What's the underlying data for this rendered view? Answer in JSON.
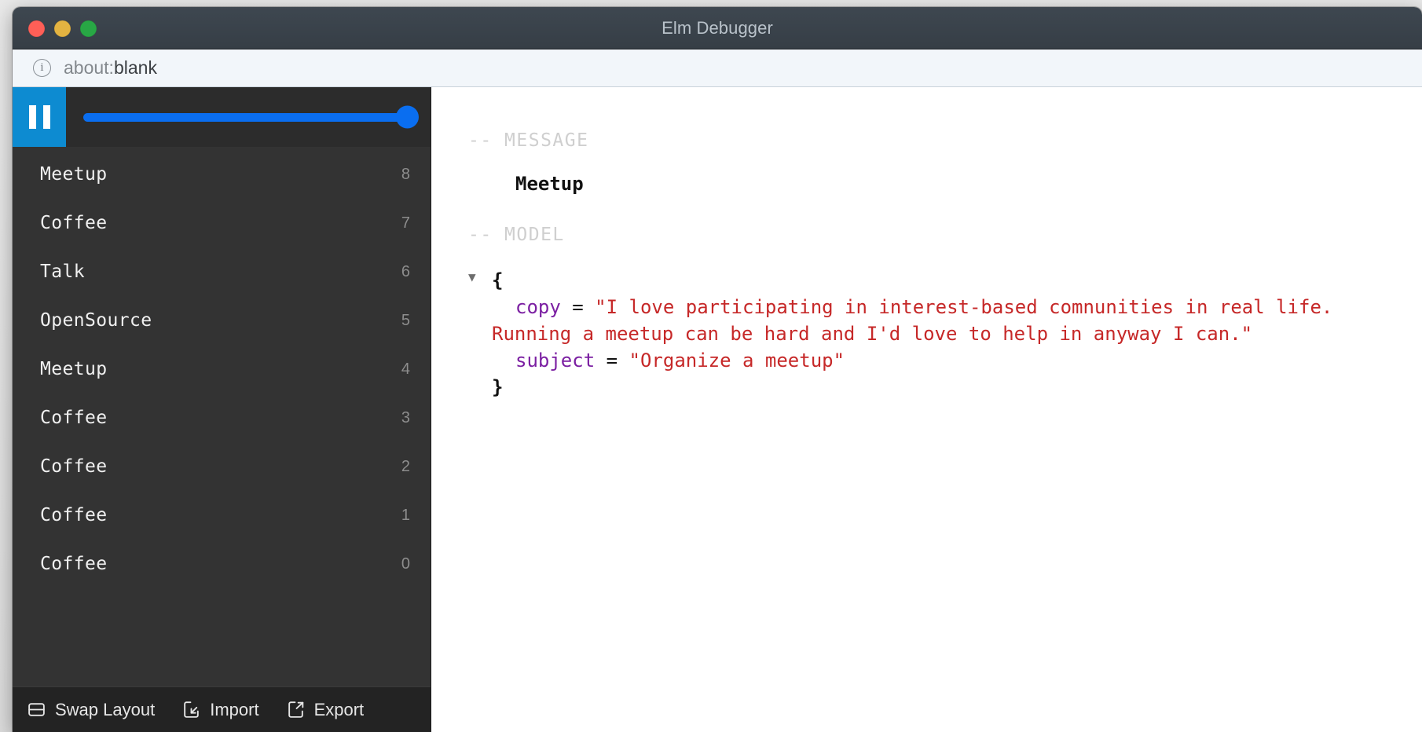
{
  "window": {
    "title": "Elm Debugger",
    "traffic_lights": [
      {
        "name": "close",
        "color": "#ff5f57"
      },
      {
        "name": "minimize",
        "color": "#e3b341"
      },
      {
        "name": "zoom",
        "color": "#28a745"
      }
    ]
  },
  "urlbar": {
    "info_icon": "info-icon",
    "scheme": "about:",
    "host": "blank",
    "full_url": "about:blank"
  },
  "sidebar": {
    "player": {
      "pause_label": "Pause",
      "pause_icon": "pause-icon",
      "slider_value": 100,
      "slider_min": 0,
      "slider_max": 100,
      "accent_color": "#0a6ef0",
      "pause_button_color": "#0d8bd1"
    },
    "history": [
      {
        "label": "Meetup",
        "index": "8"
      },
      {
        "label": "Coffee",
        "index": "7"
      },
      {
        "label": "Talk",
        "index": "6"
      },
      {
        "label": "OpenSource",
        "index": "5"
      },
      {
        "label": "Meetup",
        "index": "4"
      },
      {
        "label": "Coffee",
        "index": "3"
      },
      {
        "label": "Coffee",
        "index": "2"
      },
      {
        "label": "Coffee",
        "index": "1"
      },
      {
        "label": "Coffee",
        "index": "0"
      }
    ],
    "footer": {
      "swap_layout": "Swap Layout",
      "import": "Import",
      "export": "Export"
    }
  },
  "main": {
    "message_header": "-- MESSAGE",
    "message_value": "Meetup",
    "model_header": "-- MODEL",
    "expander": "▼",
    "brace_open": "{",
    "brace_close": "}",
    "fields": [
      {
        "key": "copy",
        "equals": "=",
        "value": "\"I love participating in interest-based comnunities in real life. Running a meetup can be hard and I'd love to help in anyway I can.\""
      },
      {
        "key": "subject",
        "equals": "=",
        "value": "\"Organize a meetup\""
      }
    ],
    "colors": {
      "key": "#7b1fa2",
      "string": "#c62828",
      "header": "#cfcfcf"
    }
  }
}
